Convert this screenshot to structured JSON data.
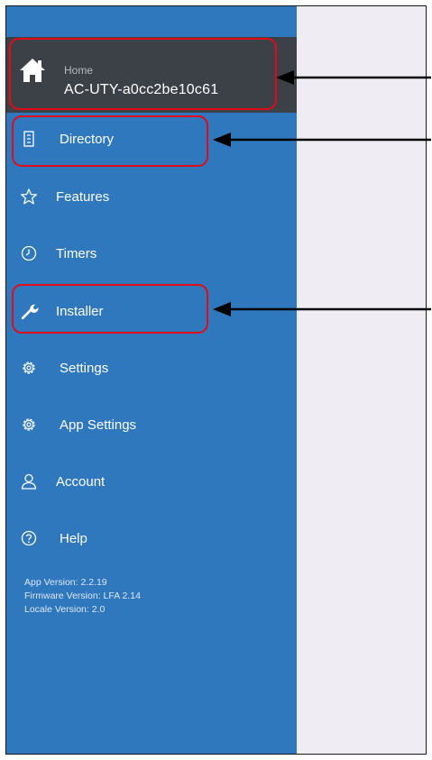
{
  "home": {
    "label": "Home",
    "device": "AC-UTY-a0cc2be10c61"
  },
  "menu": [
    {
      "label": "Directory",
      "icon": "directory-icon"
    },
    {
      "label": "Features",
      "icon": "star-icon"
    },
    {
      "label": "Timers",
      "icon": "clock-icon"
    },
    {
      "label": "Installer",
      "icon": "wrench-icon"
    },
    {
      "label": "Settings",
      "icon": "gear-icon"
    },
    {
      "label": "App Settings",
      "icon": "gear-icon"
    },
    {
      "label": "Account",
      "icon": "person-icon"
    },
    {
      "label": "Help",
      "icon": "help-icon"
    }
  ],
  "versions": {
    "app": "App Version: 2.2.19",
    "firmware": "Firmware Version: LFA 2.14",
    "locale": "Locale Version: 2.0"
  },
  "colors": {
    "sidebar": "#2f78bd",
    "header": "#3c4148",
    "content": "#efedf3",
    "highlight": "#e10c17"
  }
}
